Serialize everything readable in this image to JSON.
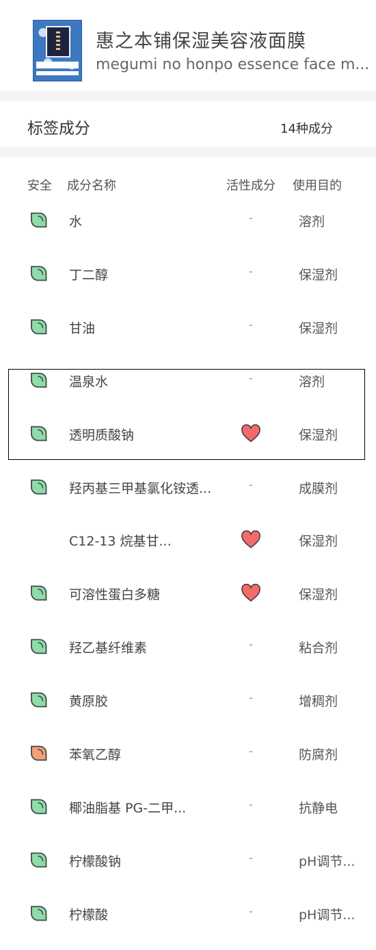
{
  "product": {
    "name_cn": "惠之本铺保湿美容液面膜",
    "name_en": "megumi no honpo essence face m...",
    "image_icon": "face-mask-package-image"
  },
  "ingredients_section": {
    "title": "标签成分",
    "count": "14种成分"
  },
  "columns": {
    "safety": "安全",
    "name": "成分名称",
    "active": "活性成分",
    "purpose": "使用目的"
  },
  "colors": {
    "safe_green": "#8fdcaa",
    "caution_orange": "#f2a07a",
    "heart_red": "#f26b6b",
    "leaf_stroke": "#3e4a44"
  },
  "ingredients": [
    {
      "name": "水",
      "safety": "green",
      "active": "-",
      "purpose": "溶剂"
    },
    {
      "name": "丁二醇",
      "safety": "green",
      "active": "-",
      "purpose": "保湿剂"
    },
    {
      "name": "甘油",
      "safety": "green",
      "active": "-",
      "purpose": "保湿剂"
    },
    {
      "name": "温泉水",
      "safety": "green",
      "active": "-",
      "purpose": "溶剂"
    },
    {
      "name": "透明质酸钠",
      "safety": "green",
      "active": "heart-icon",
      "purpose": "保湿剂"
    },
    {
      "name": "羟丙基三甲基氯化铵透...",
      "safety": "green",
      "active": "-",
      "purpose": "成膜剂"
    },
    {
      "name": "C12-13 烷基甘...",
      "safety": "none",
      "active": "heart-icon",
      "purpose": "保湿剂"
    },
    {
      "name": "可溶性蛋白多糖",
      "safety": "green",
      "active": "heart-icon",
      "purpose": "保湿剂"
    },
    {
      "name": "羟乙基纤维素",
      "safety": "green",
      "active": "-",
      "purpose": "粘合剂"
    },
    {
      "name": "黄原胶",
      "safety": "green",
      "active": "-",
      "purpose": "增稠剂"
    },
    {
      "name": "苯氧乙醇",
      "safety": "orange",
      "active": "-",
      "purpose": "防腐剂"
    },
    {
      "name": "椰油脂基 PG-二甲...",
      "safety": "green",
      "active": "-",
      "purpose": "抗静电"
    },
    {
      "name": "柠檬酸钠",
      "safety": "green",
      "active": "-",
      "purpose": "pH调节..."
    },
    {
      "name": "柠檬酸",
      "safety": "green",
      "active": "-",
      "purpose": "pH调节..."
    }
  ]
}
